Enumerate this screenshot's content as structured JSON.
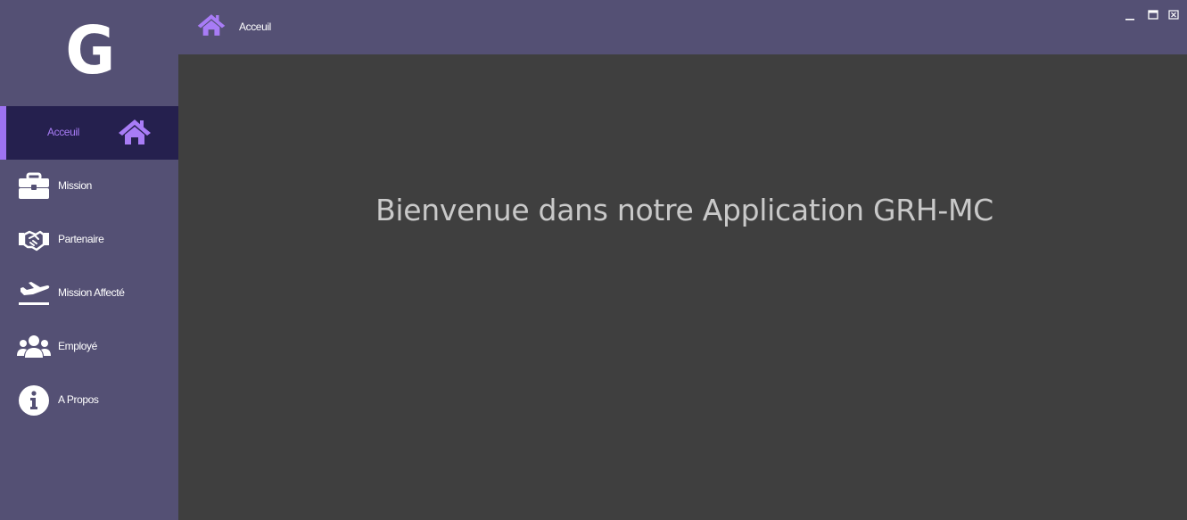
{
  "logo": {
    "letter": "G"
  },
  "header": {
    "title": "Acceuil",
    "icon": "home-icon"
  },
  "window_controls": [
    {
      "name": "minimize-button",
      "icon": "minimize-icon"
    },
    {
      "name": "maximize-button",
      "icon": "maximize-icon"
    },
    {
      "name": "close-button",
      "icon": "close-icon"
    }
  ],
  "sidebar": {
    "items": [
      {
        "label": "Acceuil",
        "icon": "home-icon",
        "active": true
      },
      {
        "label": "Mission",
        "icon": "briefcase-icon"
      },
      {
        "label": "Partenaire",
        "icon": "handshake-icon"
      },
      {
        "label": "Mission Affecté",
        "icon": "plane-departure-icon"
      },
      {
        "label": "Employé",
        "icon": "users-icon"
      },
      {
        "label": "A Propos",
        "icon": "info-icon"
      }
    ]
  },
  "main": {
    "welcome_text": "Bienvenue dans notre Application GRH-MC"
  },
  "colors": {
    "sidebar_bg": "#545074",
    "active_bg": "#25204e",
    "accent": "#9d73f2",
    "content_bg": "#3f3f3f",
    "text_light": "#ffffff",
    "welcome_text": "#c9c9c9"
  }
}
